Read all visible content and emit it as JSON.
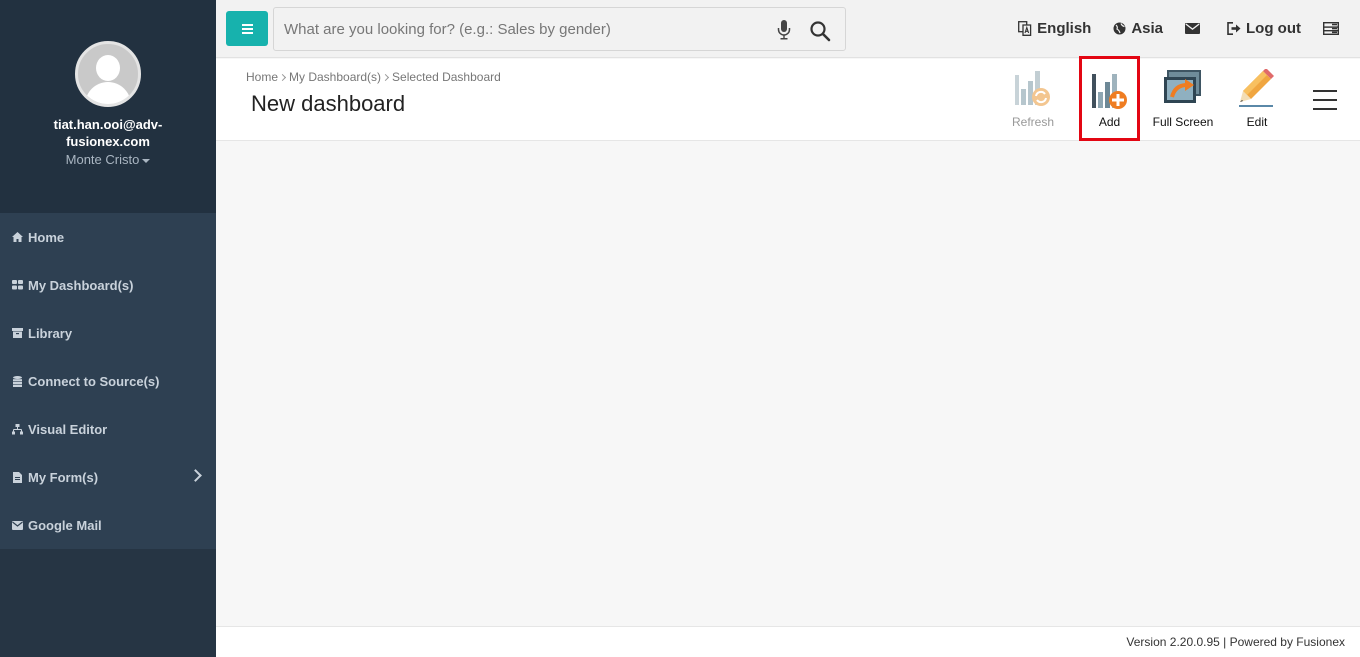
{
  "sidebar": {
    "email": "tiat.han.ooi@adv-fusionex.com",
    "user_name": "Monte Cristo",
    "items": [
      {
        "label": "Home",
        "icon": "home-icon"
      },
      {
        "label": "My Dashboard(s)",
        "icon": "dashboard-grid-icon"
      },
      {
        "label": "Library",
        "icon": "archive-icon"
      },
      {
        "label": "Connect to Source(s)",
        "icon": "database-icon"
      },
      {
        "label": "Visual Editor",
        "icon": "sitemap-icon"
      },
      {
        "label": "My Form(s)",
        "icon": "file-icon"
      },
      {
        "label": "Google Mail",
        "icon": "envelope-icon"
      }
    ]
  },
  "topbar": {
    "search_placeholder": "What are you looking for? (e.g.: Sales by gender)",
    "language": "English",
    "region": "Asia",
    "logout": "Log out"
  },
  "header": {
    "breadcrumb": [
      "Home",
      "My Dashboard(s)",
      "Selected Dashboard"
    ],
    "title": "New dashboard",
    "tools": {
      "refresh": "Refresh",
      "add": "Add",
      "full_screen": "Full Screen",
      "edit": "Edit"
    }
  },
  "footer": {
    "version": "Version 2.20.0.95 | Powered by Fusionex"
  },
  "colors": {
    "sidebar_bg": "#263544",
    "accent": "#17b2ad",
    "highlight": "#e30613"
  }
}
